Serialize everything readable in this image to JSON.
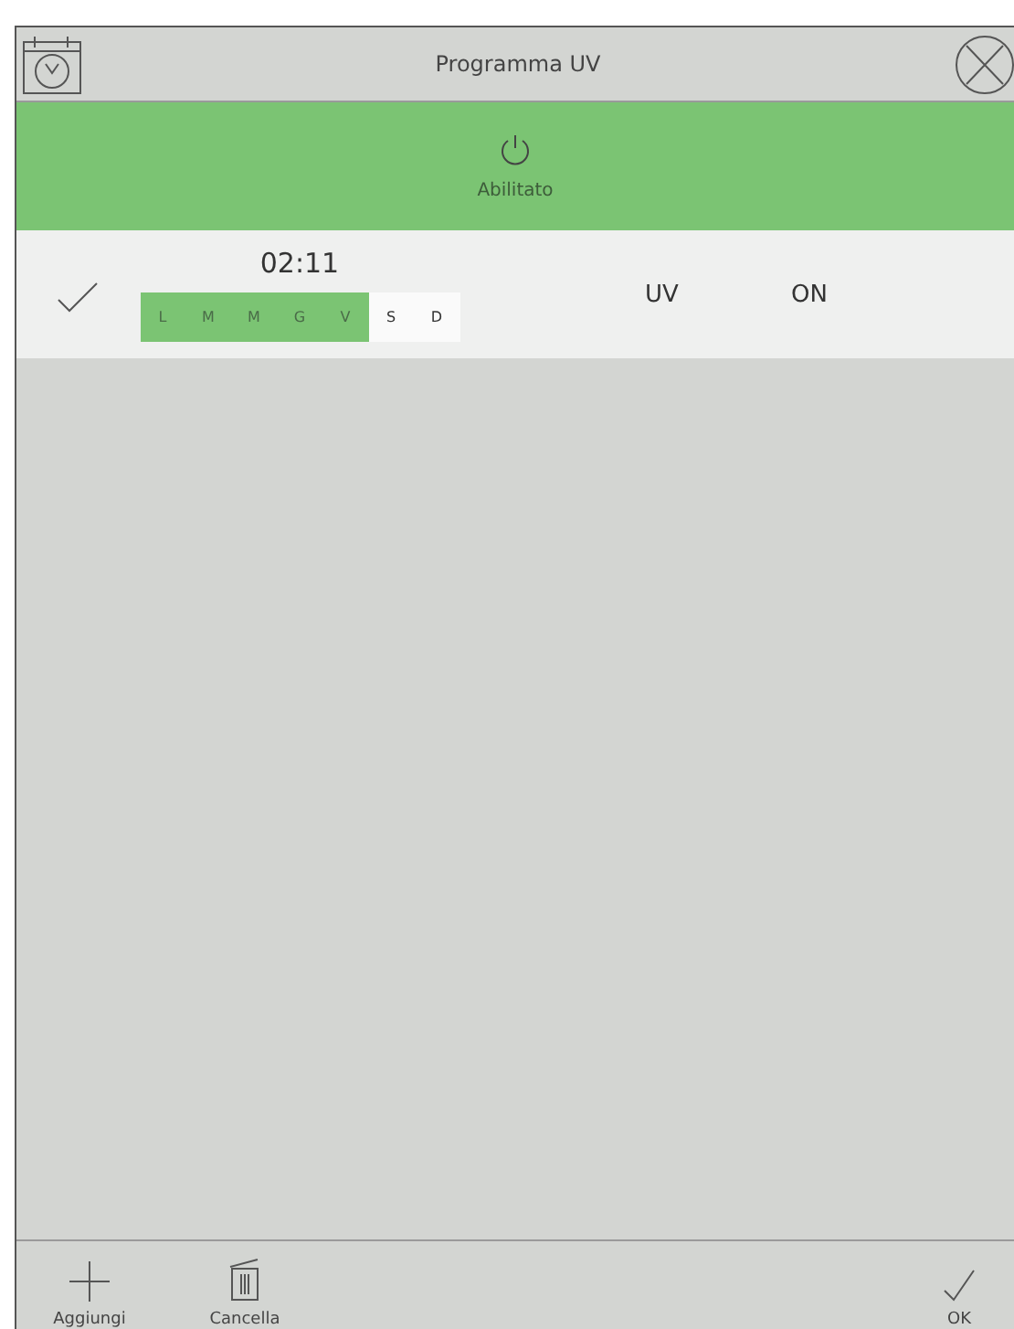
{
  "window": {
    "title": "Programma UV"
  },
  "enable_panel": {
    "label": "Abilitato",
    "enabled": true
  },
  "programs": [
    {
      "checked": true,
      "time": "02:11",
      "target": "UV",
      "action": "ON",
      "days": [
        {
          "label": "L",
          "selected": true
        },
        {
          "label": "M",
          "selected": true
        },
        {
          "label": "M",
          "selected": true
        },
        {
          "label": "G",
          "selected": true
        },
        {
          "label": "V",
          "selected": true
        },
        {
          "label": "S",
          "selected": false
        },
        {
          "label": "D",
          "selected": false
        }
      ]
    }
  ],
  "toolbar": [
    {
      "kind": "add",
      "label": "Aggiungi"
    },
    {
      "kind": "delete",
      "label": "Cancella"
    },
    {
      "kind": "ok",
      "label": "OK"
    }
  ]
}
